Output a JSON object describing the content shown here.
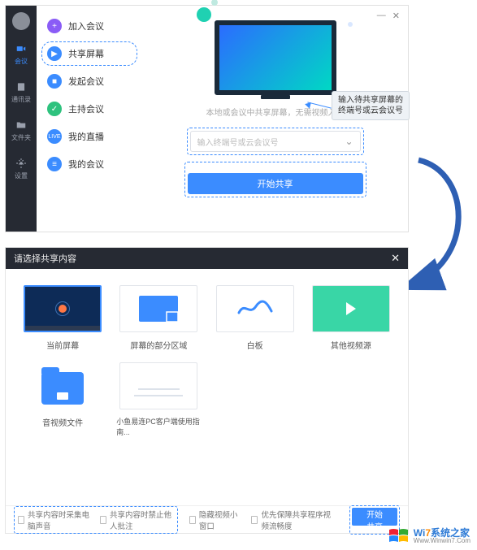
{
  "sidebar": {
    "items": [
      "会议",
      "通讯录",
      "文件夹",
      "设置"
    ]
  },
  "menu": {
    "items": [
      {
        "label": "加入会议",
        "icon": "plus",
        "color": "c-purple"
      },
      {
        "label": "共享屏幕",
        "icon": "share",
        "color": "c-blue",
        "selected": true
      },
      {
        "label": "发起会议",
        "icon": "video",
        "color": "c-blue"
      },
      {
        "label": "主持会议",
        "icon": "host",
        "color": "c-green"
      },
      {
        "label": "我的直播",
        "icon": "live",
        "color": "c-blue"
      },
      {
        "label": "我的会议",
        "icon": "list",
        "color": "c-blue"
      }
    ]
  },
  "main": {
    "caption": "本地或会议中共享屏幕，无需视频入会",
    "placeholder": "输入终端号或云会议号",
    "start_label": "开始共享",
    "tooltip": "输入待共享屏幕的终端号或云会议号"
  },
  "dialog": {
    "title": "请选择共享内容",
    "cards": [
      {
        "label": "当前屏幕",
        "kind": "desktop",
        "selected": true
      },
      {
        "label": "屏幕的部分区域",
        "kind": "part"
      },
      {
        "label": "白板",
        "kind": "whiteboard"
      },
      {
        "label": "其他视频源",
        "kind": "video"
      },
      {
        "label": "音视频文件",
        "kind": "folder"
      },
      {
        "label": "小鱼易连PC客户端使用指南...",
        "kind": "doc"
      }
    ],
    "footer": {
      "opt1": "共享内容时采集电脑声音",
      "opt2": "共享内容时禁止他人批注",
      "opt3": "隐藏视频小窗口",
      "opt4": "优先保障共享程序视频流畅度",
      "share": "开始共享"
    }
  },
  "watermark": {
    "brand_prefix": "Wi",
    "brand_suffix": "7",
    "brand_tail": "系统之家",
    "sub": "Www.Winwin7.Com"
  }
}
